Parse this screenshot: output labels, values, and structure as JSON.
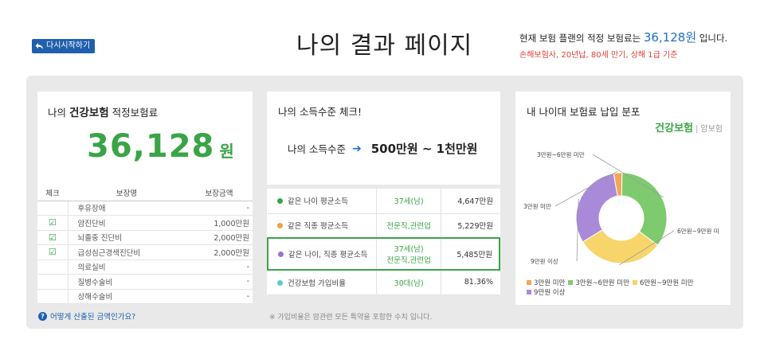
{
  "header": {
    "restart_label": "다시시작하기",
    "title": "나의 결과 페이지",
    "premium_prefix": "현재 보험 플랜의 적정 보험료는",
    "premium_amount": "36,128원",
    "premium_suffix": "입니다.",
    "premium_note": "손해보험사, 20년납, 80세 만기, 상해 1급 기준"
  },
  "health_card": {
    "title_prefix": "나의",
    "title_bold": "건강보험",
    "title_suffix": "적정보험료",
    "amount": "36,128",
    "unit": "원",
    "table_headers": [
      "체크",
      "보장명",
      "보장금액"
    ],
    "rows": [
      {
        "checked": false,
        "name": "후유장애",
        "amount": "-"
      },
      {
        "checked": true,
        "name": "암진단비",
        "amount": "1,000만원"
      },
      {
        "checked": true,
        "name": "뇌졸중 진단비",
        "amount": "2,000만원"
      },
      {
        "checked": true,
        "name": "급성심근경색진단비",
        "amount": "2,000만원"
      },
      {
        "checked": false,
        "name": "의료실비",
        "amount": "-"
      },
      {
        "checked": false,
        "name": "질병수술비",
        "amount": "-"
      },
      {
        "checked": false,
        "name": "상해수술비",
        "amount": "-"
      }
    ],
    "help_link": "어떻게 산출된 금액인가요?"
  },
  "income_card": {
    "title": "나의 소득수준 체크!",
    "level_label": "나의 소득수준",
    "level_value": "500만원 ~ 1천만원",
    "rows": [
      {
        "label": "같은 나이 평균소득",
        "tag": "37세(남)",
        "tag2": "",
        "value": "4,647만원",
        "dot_color": "#3aa447",
        "highlight": false
      },
      {
        "label": "같은 직종 평균소득",
        "tag": "전문직,관련업",
        "tag2": "",
        "value": "5,229만원",
        "dot_color": "#f5a041",
        "highlight": false
      },
      {
        "label": "같은 나이, 직종 평균소득",
        "tag": "37세(남)",
        "tag2": "전문직,관련업",
        "value": "5,485만원",
        "dot_color": "#9b72c6",
        "highlight": true
      },
      {
        "label": "건강보험 가입비율",
        "tag": "30대(남)",
        "tag2": "",
        "value": "81.36%",
        "dot_color": "#5bc8d6",
        "highlight": false
      }
    ],
    "footnote": "※ 가입비율은 암관련 모든 특약을 포함한 수치 입니다."
  },
  "distribution_card": {
    "title": "내 나이대 보험료 납입 분포",
    "tab_active": "건강보험",
    "tab_inactive": "암보험",
    "chart_data": {
      "type": "pie",
      "donut": true,
      "categories": [
        "3만원 미만",
        "3만원~6만원 미만",
        "6만원~9만원 미만",
        "9만원 이상"
      ],
      "values": [
        3,
        35,
        31,
        31
      ],
      "colors": [
        "#f5a55a",
        "#7dcb6e",
        "#f7d56b",
        "#a98ad9"
      ],
      "slice_labels": [
        "3만원 미만",
        "3만원~6만원 미만",
        "6만원~9만원 미",
        "9만원 이상"
      ],
      "legend": "bottom"
    }
  }
}
